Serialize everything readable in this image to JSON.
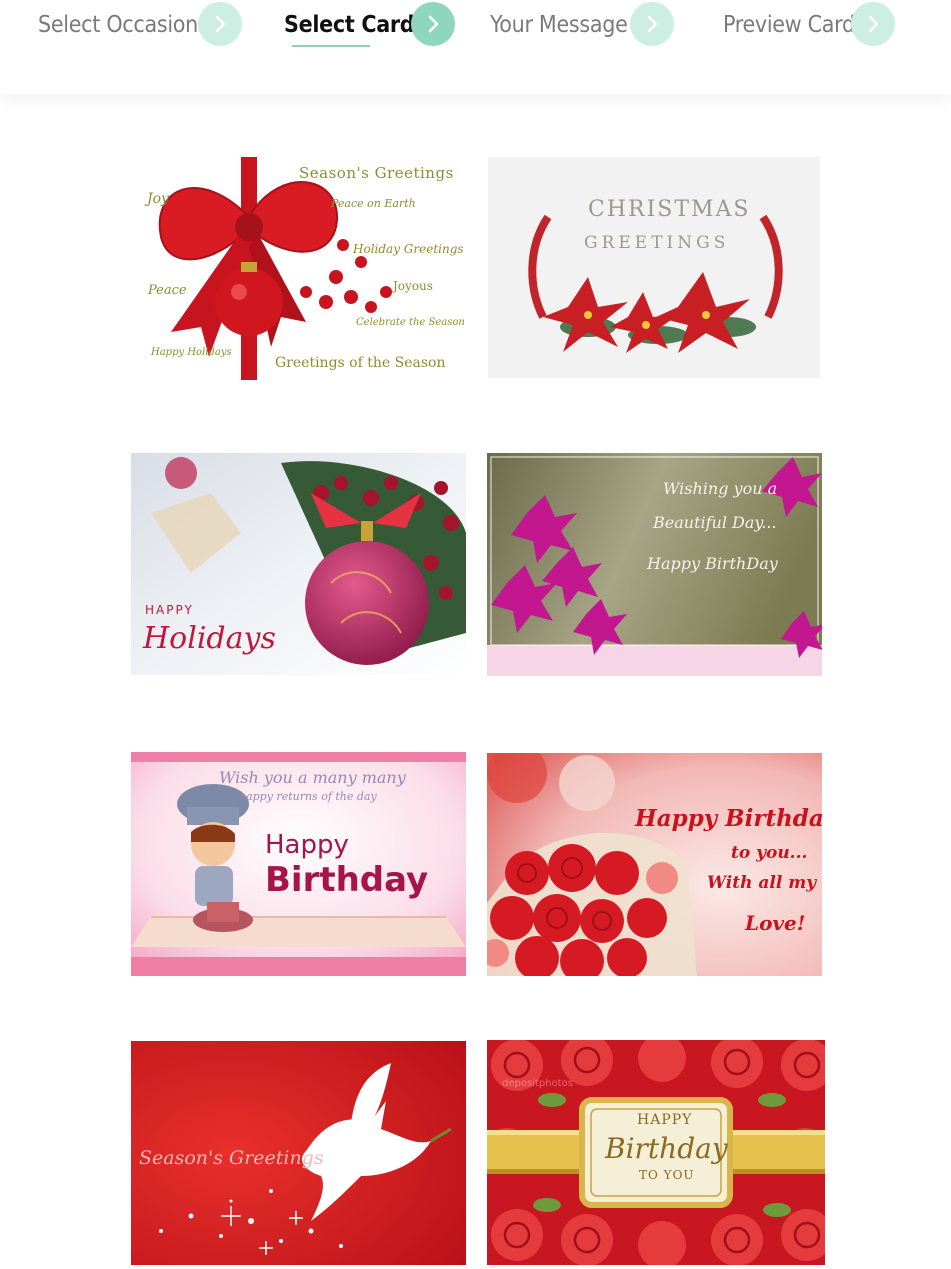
{
  "colors": {
    "accent": "#8fd6bf",
    "accent_light": "#cdeee3",
    "inactive_text": "#7a7a7a",
    "active_text": "#111111"
  },
  "steps": [
    {
      "label": "Select Occasion",
      "icon": "chevron-right-icon",
      "active": false
    },
    {
      "label": "Select Card",
      "icon": "chevron-right-icon",
      "active": true
    },
    {
      "label": "Your Message",
      "icon": "chevron-right-icon",
      "active": false
    },
    {
      "label": "Preview Card",
      "icon": "chevron-right-icon",
      "active": false
    }
  ],
  "cards": [
    {
      "id": "seasons-greetings-bow",
      "texts": [
        "Season's Greetings",
        "Joy",
        "Peace on Earth",
        "Holiday Greetings",
        "Joyous",
        "Peace",
        "Celebrate the Season",
        "Happy Holidays",
        "Greetings of the Season"
      ]
    },
    {
      "id": "christmas-greetings-poinsettia",
      "texts": [
        "CHRISTMAS",
        "GREETINGS"
      ]
    },
    {
      "id": "happy-holidays-ornament",
      "texts": [
        "HAPPY",
        "Holidays"
      ]
    },
    {
      "id": "orchid-birthday",
      "texts": [
        "Wishing you a",
        "Beautiful Day...",
        "Happy BirthDay"
      ]
    },
    {
      "id": "chef-boy-birthday",
      "texts": [
        "Wish you a many many",
        "happy returns of the day",
        "Happy",
        "Birthday"
      ]
    },
    {
      "id": "roses-birthday-love",
      "texts": [
        "Happy Birthday",
        "to you...",
        "With all my",
        "Love!"
      ]
    },
    {
      "id": "dove-seasons-greetings",
      "texts": [
        "Season's Greetings"
      ]
    },
    {
      "id": "roses-happy-birthday-to-you",
      "texts": [
        "depositphotos",
        "HAPPY",
        "Birthday",
        "TO YOU"
      ]
    }
  ]
}
